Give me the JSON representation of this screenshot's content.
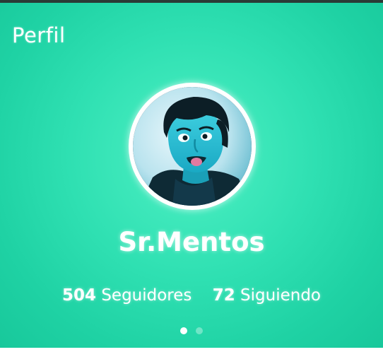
{
  "header": {
    "title": "Perfil"
  },
  "profile": {
    "username": "Sr.Mentos",
    "followers_count": "504",
    "followers_label": "Seguidores",
    "following_count": "72",
    "following_label": "Siguiendo"
  },
  "pager": {
    "pages": 2,
    "active": 0
  },
  "colors": {
    "background": "#2fe0b2",
    "text": "#ffffff"
  }
}
